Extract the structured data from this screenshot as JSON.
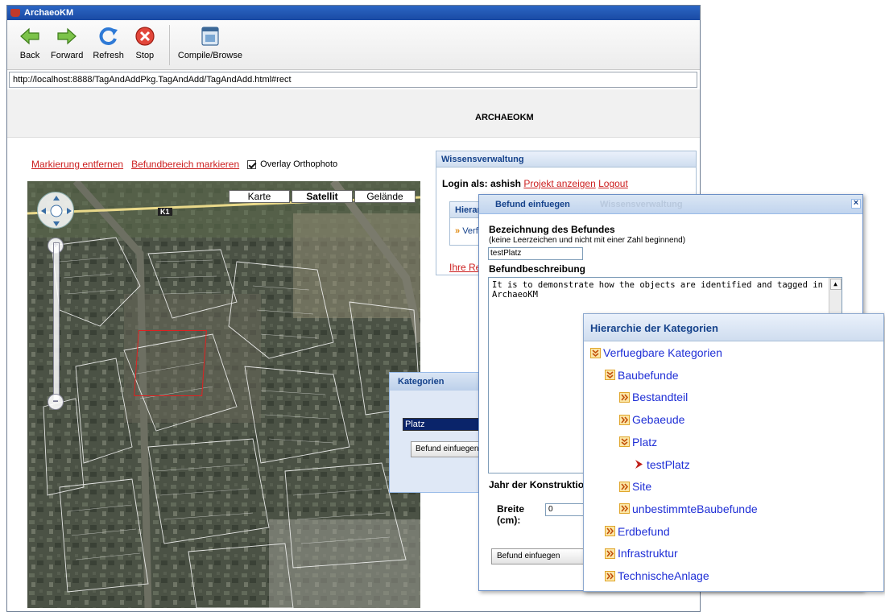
{
  "window": {
    "title": "ArchaeoKM"
  },
  "toolbar": {
    "buttons": [
      {
        "label": "Back",
        "icon": "back-arrow-icon"
      },
      {
        "label": "Forward",
        "icon": "forward-arrow-icon"
      },
      {
        "label": "Refresh",
        "icon": "refresh-icon"
      },
      {
        "label": "Stop",
        "icon": "stop-icon"
      },
      {
        "label": "Compile/Browse",
        "icon": "compile-browse-icon"
      }
    ]
  },
  "address_bar": {
    "url": "http://localhost:8888/TagAndAddPkg.TagAndAdd/TagAndAdd.html#rect"
  },
  "page": {
    "title": "ARCHAEOKM",
    "map_links": {
      "remove_marking": "Markierung entfernen",
      "mark_area": "Befundbereich markieren",
      "overlay_label": "Overlay Orthophoto",
      "overlay_checked": true
    },
    "map": {
      "types": [
        "Karte",
        "Satellit",
        "Gelände"
      ],
      "active_type": "Satellit",
      "road_label": "K1"
    }
  },
  "wissen_panel": {
    "title": "Wissensverwaltung",
    "login_prefix": "Login als: ashish",
    "project_link": "Projekt anzeigen",
    "logout_link": "Logout",
    "hier_header": "Hierar",
    "hier_item": "Verf",
    "ihre_link": "Ihre Re"
  },
  "kategorien_dialog": {
    "title": "Kategorien",
    "selected": "Platz",
    "button": "Befund einfuegen"
  },
  "befund_dialog": {
    "title": "Befund einfuegen",
    "ghost_title": "Wissensverwaltung",
    "name_label": "Bezeichnung des Befundes",
    "name_hint": "(keine Leerzeichen und nicht mit einer Zahl beginnend)",
    "name_value": "testPlatz",
    "desc_label": "Befundbeschreibung",
    "desc_value": "It is to demonstrate how the objects are identified and tagged in ArchaeoKM",
    "year_label": "Jahr der Konstruktion",
    "breite_label_1": "Breite",
    "breite_label_2": "(cm):",
    "breite_value": "0",
    "submit": "Befund einfuegen"
  },
  "hierarchy_panel": {
    "title": "Hierarchie der Kategorien",
    "items": [
      {
        "label": "Verfuegbare Kategorien",
        "icon": "expanded-chevron-icon",
        "level": 0
      },
      {
        "label": "Baubefunde",
        "icon": "expanded-chevron-icon",
        "level": 1
      },
      {
        "label": "Bestandteil",
        "icon": "collapsed-chevron-icon",
        "level": 2
      },
      {
        "label": "Gebaeude",
        "icon": "collapsed-chevron-icon",
        "level": 2
      },
      {
        "label": "Platz",
        "icon": "expanded-chevron-icon",
        "level": 2
      },
      {
        "label": "testPlatz",
        "icon": "leaf-arrow-icon",
        "level": 3
      },
      {
        "label": "Site",
        "icon": "collapsed-chevron-icon",
        "level": 2
      },
      {
        "label": "unbestimmteBaubefunde",
        "icon": "collapsed-chevron-icon",
        "level": 2
      },
      {
        "label": "Erdbefund",
        "icon": "collapsed-chevron-icon",
        "level": 1
      },
      {
        "label": "Infrastruktur",
        "icon": "collapsed-chevron-icon",
        "level": 1
      },
      {
        "label": "TechnischeAnlage",
        "icon": "collapsed-chevron-icon",
        "level": 1
      }
    ]
  }
}
